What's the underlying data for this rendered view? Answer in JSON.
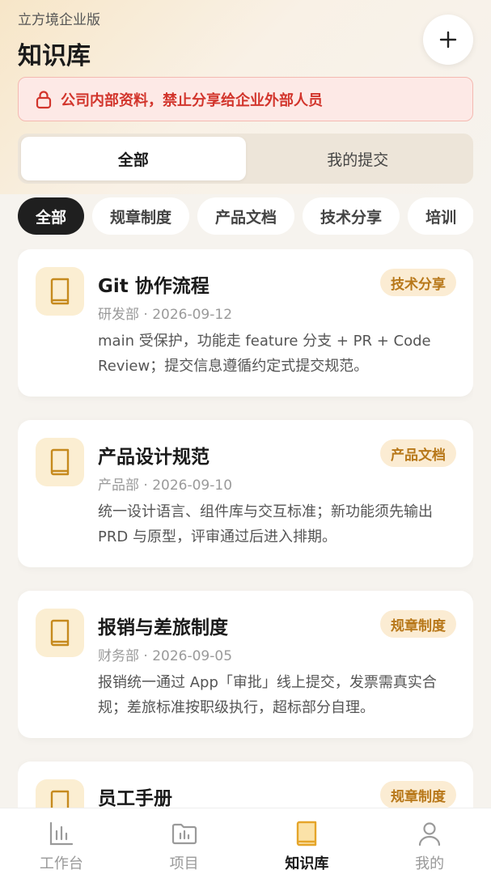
{
  "header": {
    "org_name": "立方境企业版",
    "title": "知识库",
    "add_icon": "plus-icon"
  },
  "notice": {
    "icon": "lock-icon",
    "text": "公司内部资料，禁止分享给企业外部人员",
    "color": "#d2352c"
  },
  "segment": {
    "options": [
      "全部",
      "我的提交"
    ],
    "selected": "全部"
  },
  "categories": {
    "items": [
      "全部",
      "规章制度",
      "产品文档",
      "技术分享",
      "培训"
    ],
    "selected": "全部"
  },
  "docs": [
    {
      "title": "Git 协作流程",
      "tag": "技术分享",
      "meta": "研发部 · 2026-09-12",
      "desc": "main 受保护，功能走 feature 分支 + PR + Code Review；提交信息遵循约定式提交规范。"
    },
    {
      "title": "产品设计规范",
      "tag": "产品文档",
      "meta": "产品部 · 2026-09-10",
      "desc": "统一设计语言、组件库与交互标准；新功能须先输出 PRD 与原型，评审通过后进入排期。"
    },
    {
      "title": "报销与差旅制度",
      "tag": "规章制度",
      "meta": "财务部 · 2026-09-05",
      "desc": "报销统一通过 App「审批」线上提交，发票需真实合规；差旅标准按职级执行，超标部分自理。"
    },
    {
      "title": "员工手册",
      "tag": "规章制度",
      "meta": "",
      "desc": ""
    }
  ],
  "tabbar": {
    "items": [
      {
        "label": "工作台",
        "icon": "bar-chart-icon"
      },
      {
        "label": "项目",
        "icon": "folder-chart-icon"
      },
      {
        "label": "知识库",
        "icon": "book-icon"
      },
      {
        "label": "我的",
        "icon": "user-icon"
      }
    ],
    "active": "知识库"
  },
  "colors": {
    "accent": "#e5a52a",
    "tag_bg": "#fbecd3",
    "tag_text": "#b8781a"
  }
}
